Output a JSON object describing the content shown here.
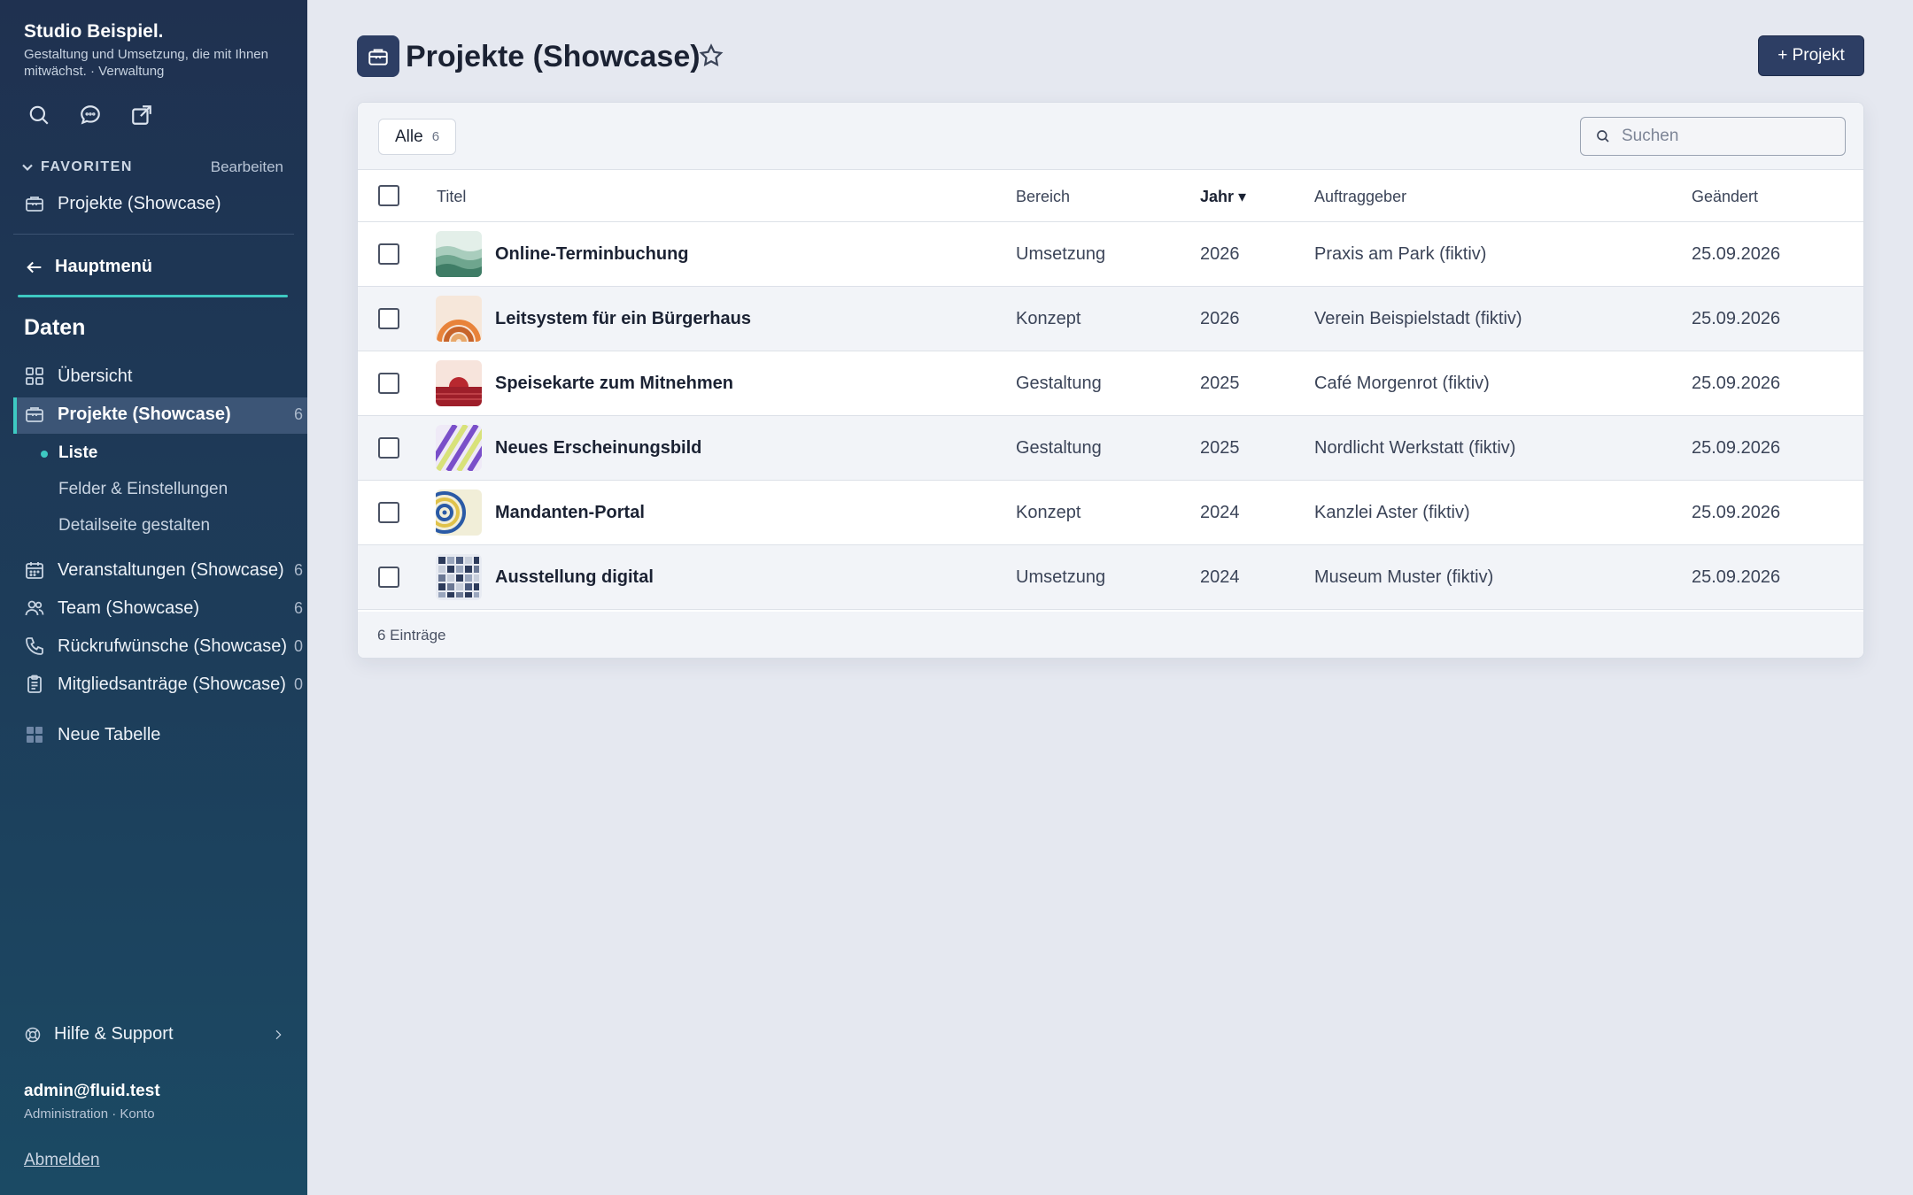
{
  "brand": {
    "name": "Studio Beispiel.",
    "tagline": "Gestaltung und Umsetzung, die mit Ihnen mitwächst. · Verwaltung"
  },
  "sidebar": {
    "favorites_title": "FAVORITEN",
    "favorites_edit": "Bearbeiten",
    "favorites": [
      {
        "label": "Projekte (Showcase)"
      }
    ],
    "back_label": "Hauptmenü",
    "section_title": "Daten",
    "items": [
      {
        "label": "Übersicht",
        "icon": "grid-icon"
      },
      {
        "label": "Projekte (Showcase)",
        "count": "6",
        "icon": "briefcase-icon"
      },
      {
        "label": "Veranstaltungen (Showcase)",
        "count": "6",
        "icon": "calendar-icon"
      },
      {
        "label": "Team (Showcase)",
        "count": "6",
        "icon": "users-icon"
      },
      {
        "label": "Rückrufwünsche (Showcase)",
        "count": "0",
        "icon": "phone-icon"
      },
      {
        "label": "Mitgliedsanträge (Showcase)",
        "count": "0",
        "icon": "clipboard-icon"
      },
      {
        "label": "Neue Tabelle",
        "icon": "table-plus-icon"
      }
    ],
    "sub_items": [
      {
        "label": "Liste"
      },
      {
        "label": "Felder & Einstellungen"
      },
      {
        "label": "Detailseite gestalten"
      }
    ],
    "help_label": "Hilfe & Support",
    "user_email": "admin@fluid.test",
    "user_role": "Administration · Konto",
    "logout_label": "Abmelden"
  },
  "header": {
    "title": "Projekte (Showcase)",
    "new_button": "+ Projekt"
  },
  "toolbar": {
    "filter_label": "Alle",
    "filter_count": "6",
    "search_placeholder": "Suchen"
  },
  "table": {
    "columns": [
      "Titel",
      "Bereich",
      "Jahr ▾",
      "Auftraggeber",
      "Geändert"
    ],
    "rows": [
      {
        "title": "Online-Terminbuchung",
        "area": "Umsetzung",
        "year": "2026",
        "client": "Praxis am Park (fiktiv)",
        "changed": "25.09.2026",
        "thumb": "waves-thumb"
      },
      {
        "title": "Leitsystem für ein Bürgerhaus",
        "area": "Konzept",
        "year": "2026",
        "client": "Verein Beispielstadt (fiktiv)",
        "changed": "25.09.2026",
        "thumb": "arcs-thumb"
      },
      {
        "title": "Speisekarte zum Mitnehmen",
        "area": "Gestaltung",
        "year": "2025",
        "client": "Café Morgenrot (fiktiv)",
        "changed": "25.09.2026",
        "thumb": "sunset-thumb"
      },
      {
        "title": "Neues Erscheinungsbild",
        "area": "Gestaltung",
        "year": "2025",
        "client": "Nordlicht Werkstatt (fiktiv)",
        "changed": "25.09.2026",
        "thumb": "stripes-thumb"
      },
      {
        "title": "Mandanten-Portal",
        "area": "Konzept",
        "year": "2024",
        "client": "Kanzlei Aster (fiktiv)",
        "changed": "25.09.2026",
        "thumb": "rings-thumb"
      },
      {
        "title": "Ausstellung digital",
        "area": "Umsetzung",
        "year": "2024",
        "client": "Museum Muster (fiktiv)",
        "changed": "25.09.2026",
        "thumb": "mosaic-thumb"
      }
    ],
    "footer": "6 Einträge"
  },
  "colors": {
    "accent": "#3ec9c2",
    "primary": "#2d3e64",
    "sidebar_top": "#1f3150",
    "sidebar_bottom": "#1b4a64"
  }
}
